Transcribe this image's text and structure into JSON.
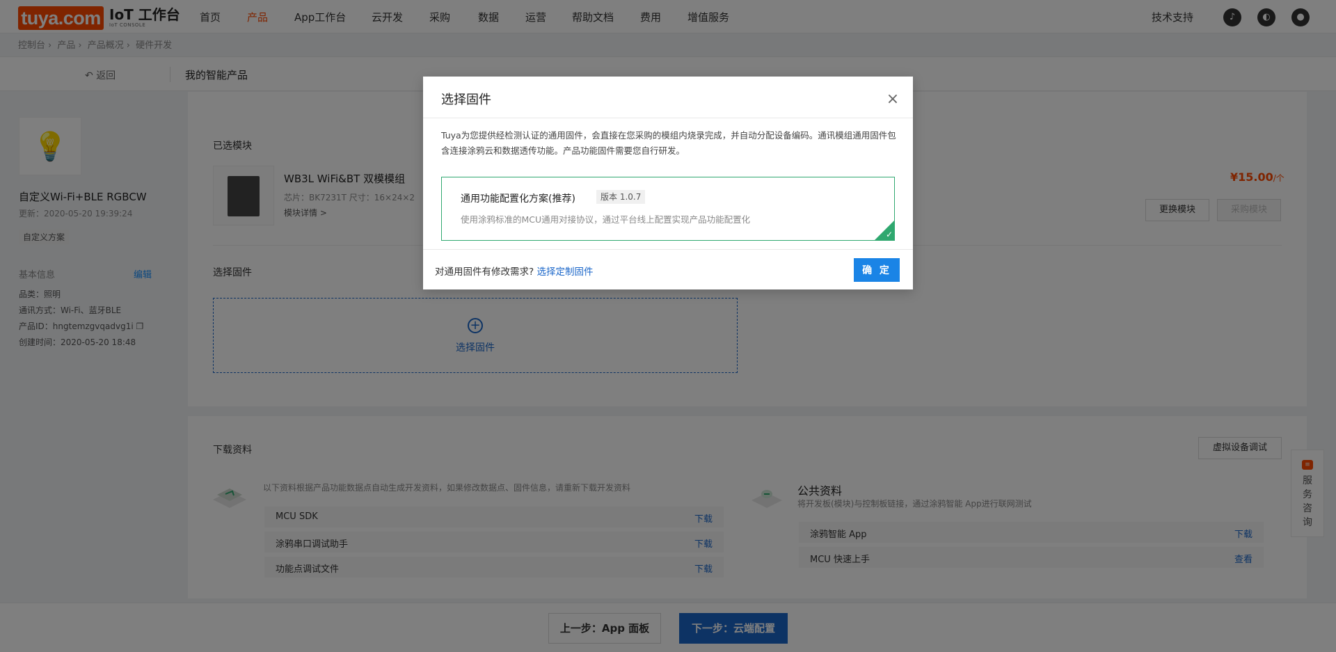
{
  "brand": {
    "logo": "tuya.com",
    "console_title": "IoT 工作台",
    "console_sub": "IoT CONSOLE"
  },
  "nav": {
    "items": [
      "首页",
      "产品",
      "App工作台",
      "云开发",
      "采购",
      "数据",
      "运营",
      "帮助文档",
      "费用",
      "增值服务"
    ],
    "active": "产品",
    "support": "技术支持"
  },
  "breadcrumb": [
    "控制台",
    "产品",
    "产品概况",
    "硬件开发"
  ],
  "subheader": {
    "back": "返回",
    "title": "我的智能产品"
  },
  "product": {
    "name": "自定义Wi-Fi+BLE RGBCW",
    "updated": "更新：2020-05-20 19:39:24",
    "tag": "自定义方案",
    "basic_label": "基本信息",
    "edit": "编辑",
    "info": [
      "品类：照明",
      "通讯方式：Wi-Fi、蓝牙BLE",
      "产品ID：hngtemzgvqadvg1i",
      "创建时间：2020-05-20 18:48"
    ]
  },
  "module": {
    "section": "已选模块",
    "name": "WB3L WiFi&BT 双模模组",
    "chip": "芯片：BK7231T  尺寸：16×24×2",
    "detail": "模块详情 >",
    "price": "¥15.00",
    "unit": "/个",
    "change": "更换模块",
    "buy": "采购模块"
  },
  "firmware": {
    "section": "选择固件",
    "select": "选择固件"
  },
  "downloads": {
    "section": "下载资料",
    "virtual": "虚拟设备调试",
    "note": "以下资料根据产品功能数据点自动生成开发资料，如果修改数据点、固件信息，请重新下载开发资料",
    "items": [
      {
        "name": "MCU SDK",
        "action": "下载"
      },
      {
        "name": "涂鸦串口调试助手",
        "action": "下载"
      },
      {
        "name": "功能点调试文件",
        "action": "下载"
      }
    ],
    "public_title": "公共资料",
    "public_sub": "将开发板(模块)与控制板链接，通过涂鸦智能 App进行联网测试",
    "public_items": [
      {
        "name": "涂鸦智能 App",
        "action": "下载"
      },
      {
        "name": "MCU 快速上手",
        "action": "查看"
      }
    ]
  },
  "service": "服务咨询",
  "footer": {
    "prev": "上一步：App 面板",
    "next": "下一步：云端配置"
  },
  "modal": {
    "title": "选择固件",
    "desc": "Tuya为您提供经检测认证的通用固件，会直接在您采购的模组内烧录完成，并自动分配设备编码。通讯模组通用固件包含连接涂鸦云和数据透传功能。产品功能固件需要您自行研发。",
    "option_name": "通用功能配置化方案(推荐)",
    "option_version": "版本 1.0.7",
    "option_desc": "使用涂鸦标准的MCU通用对接协议，通过平台线上配置实现产品功能配置化",
    "footer_question": "对通用固件有修改需求?",
    "footer_link": "选择定制固件",
    "ok": "确 定"
  },
  "colors": {
    "brand": "#ff4800",
    "primary": "#1a66c9",
    "selected": "#2fa86f"
  }
}
